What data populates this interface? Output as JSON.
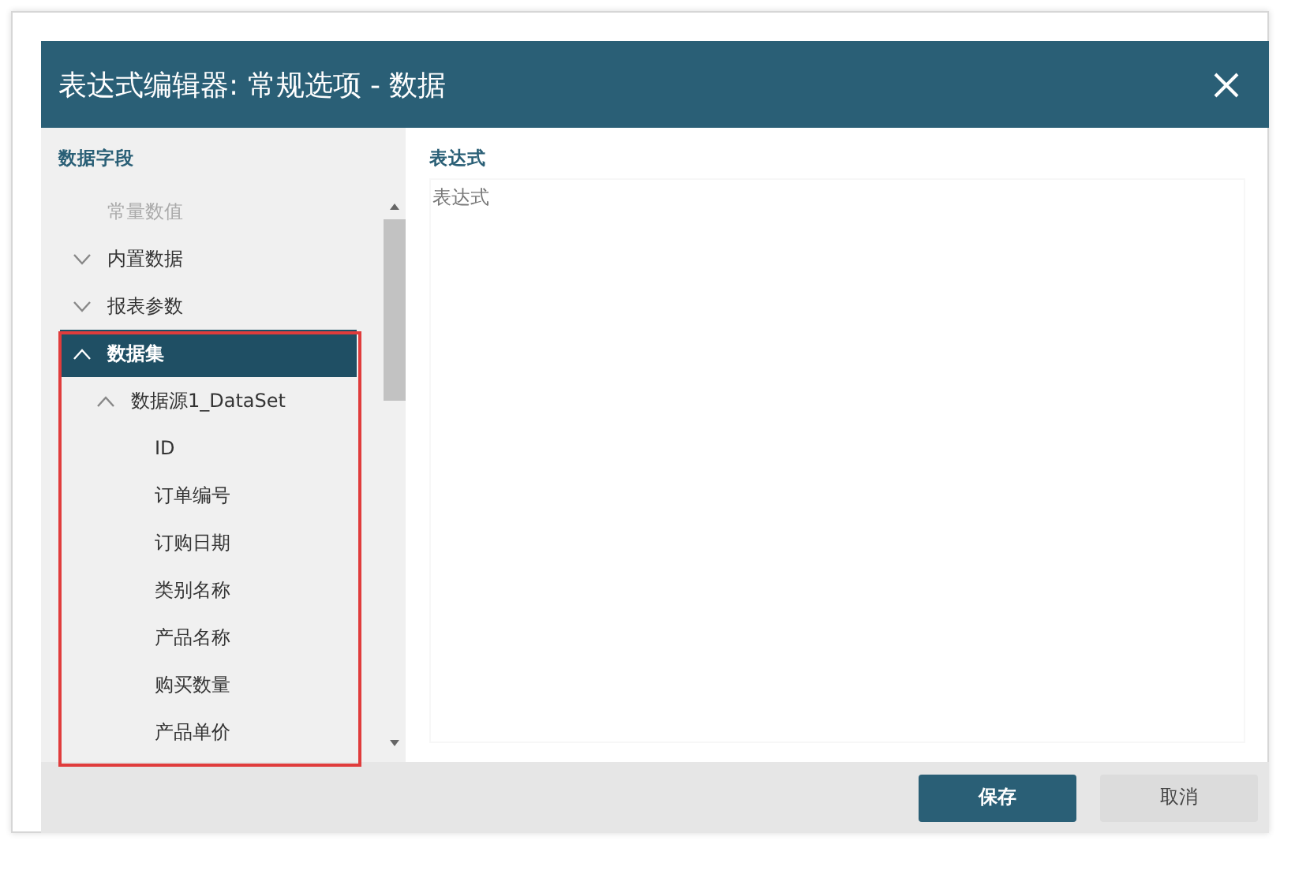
{
  "window": {
    "title": "表达式编辑器: 常规选项 - 数据"
  },
  "sidebar": {
    "heading": "数据字段",
    "items": [
      {
        "label": "常量数值",
        "kind": "leaf",
        "disabled": true,
        "selected": false
      },
      {
        "label": "内置数据",
        "kind": "folder",
        "expanded": false,
        "disabled": false,
        "selected": false
      },
      {
        "label": "报表参数",
        "kind": "folder",
        "expanded": false,
        "disabled": false,
        "selected": false
      },
      {
        "label": "数据集",
        "kind": "folder",
        "expanded": true,
        "disabled": false,
        "selected": true,
        "children": [
          {
            "label": "数据源1_DataSet",
            "kind": "folder",
            "expanded": true,
            "disabled": false,
            "selected": false,
            "children": [
              {
                "label": "ID",
                "kind": "leaf",
                "disabled": false,
                "selected": false
              },
              {
                "label": "订单编号",
                "kind": "leaf",
                "disabled": false,
                "selected": false
              },
              {
                "label": "订购日期",
                "kind": "leaf",
                "disabled": false,
                "selected": false
              },
              {
                "label": "类别名称",
                "kind": "leaf",
                "disabled": false,
                "selected": false
              },
              {
                "label": "产品名称",
                "kind": "leaf",
                "disabled": false,
                "selected": false
              },
              {
                "label": "购买数量",
                "kind": "leaf",
                "disabled": false,
                "selected": false
              },
              {
                "label": "产品单价",
                "kind": "leaf",
                "disabled": false,
                "selected": false
              }
            ]
          }
        ]
      }
    ]
  },
  "editor": {
    "heading": "表达式",
    "placeholder": "表达式"
  },
  "buttons": [
    {
      "label": "保存",
      "kind": "primary"
    },
    {
      "label": "取消",
      "kind": "secondary"
    }
  ]
}
